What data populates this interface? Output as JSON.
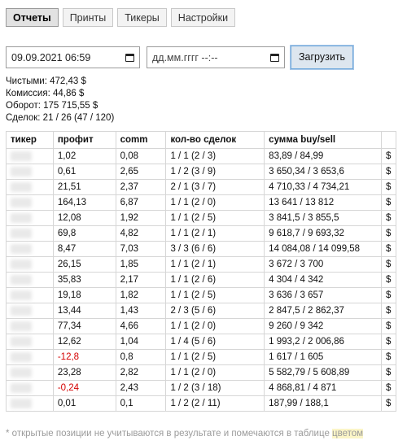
{
  "tabs": [
    "Отчеты",
    "Принты",
    "Тикеры",
    "Настройки"
  ],
  "active_tab": 0,
  "controls": {
    "date_from": "09.09.2021 06:59",
    "date_to_placeholder": "дд.мм.гггг --:--",
    "load_label": "Загрузить"
  },
  "stats": [
    "Чистыми: 472,43 $",
    "Комиссия: 44,86 $",
    "Оборот: 175 715,55 $",
    "Сделок: 21 / 26 (47 / 120)"
  ],
  "table": {
    "headers": [
      "тикер",
      "профит",
      "comm",
      "кол-во сделок",
      "сумма buy/sell",
      ""
    ],
    "rows": [
      {
        "profit": "1,02",
        "comm": "0,08",
        "deals": "1 / 1 (2 / 3)",
        "sum": "83,89 / 84,99",
        "cur": "$",
        "neg": false
      },
      {
        "profit": "0,61",
        "comm": "2,65",
        "deals": "1 / 2 (3 / 9)",
        "sum": "3 650,34 / 3 653,6",
        "cur": "$",
        "neg": false
      },
      {
        "profit": "21,51",
        "comm": "2,37",
        "deals": "2 / 1 (3 / 7)",
        "sum": "4 710,33 / 4 734,21",
        "cur": "$",
        "neg": false
      },
      {
        "profit": "164,13",
        "comm": "6,87",
        "deals": "1 / 1 (2 / 0)",
        "sum": "13 641 / 13 812",
        "cur": "$",
        "neg": false
      },
      {
        "profit": "12,08",
        "comm": "1,92",
        "deals": "1 / 1 (2 / 5)",
        "sum": "3 841,5 / 3 855,5",
        "cur": "$",
        "neg": false
      },
      {
        "profit": "69,8",
        "comm": "4,82",
        "deals": "1 / 1 (2 / 1)",
        "sum": "9 618,7 / 9 693,32",
        "cur": "$",
        "neg": false
      },
      {
        "profit": "8,47",
        "comm": "7,03",
        "deals": "3 / 3 (6 / 6)",
        "sum": "14 084,08 / 14 099,58",
        "cur": "$",
        "neg": false
      },
      {
        "profit": "26,15",
        "comm": "1,85",
        "deals": "1 / 1 (2 / 1)",
        "sum": "3 672 / 3 700",
        "cur": "$",
        "neg": false
      },
      {
        "profit": "35,83",
        "comm": "2,17",
        "deals": "1 / 1 (2 / 6)",
        "sum": "4 304 / 4 342",
        "cur": "$",
        "neg": false
      },
      {
        "profit": "19,18",
        "comm": "1,82",
        "deals": "1 / 1 (2 / 5)",
        "sum": "3 636 / 3 657",
        "cur": "$",
        "neg": false
      },
      {
        "profit": "13,44",
        "comm": "1,43",
        "deals": "2 / 3 (5 / 6)",
        "sum": "2 847,5 / 2 862,37",
        "cur": "$",
        "neg": false
      },
      {
        "profit": "77,34",
        "comm": "4,66",
        "deals": "1 / 1 (2 / 0)",
        "sum": "9 260 / 9 342",
        "cur": "$",
        "neg": false
      },
      {
        "profit": "12,62",
        "comm": "1,04",
        "deals": "1 / 4 (5 / 6)",
        "sum": "1 993,2 / 2 006,86",
        "cur": "$",
        "neg": false
      },
      {
        "profit": "-12,8",
        "comm": "0,8",
        "deals": "1 / 1 (2 / 5)",
        "sum": "1 617 / 1 605",
        "cur": "$",
        "neg": true
      },
      {
        "profit": "23,28",
        "comm": "2,82",
        "deals": "1 / 1 (2 / 0)",
        "sum": "5 582,79 / 5 608,89",
        "cur": "$",
        "neg": false
      },
      {
        "profit": "-0,24",
        "comm": "2,43",
        "deals": "1 / 2 (3 / 18)",
        "sum": "4 868,81 / 4 871",
        "cur": "$",
        "neg": true
      },
      {
        "profit": "0,01",
        "comm": "0,1",
        "deals": "1 / 2 (2 / 11)",
        "sum": "187,99 / 188,1",
        "cur": "$",
        "neg": false
      }
    ]
  },
  "footnote": {
    "text": "* открытые позиции не учитываются в результате и помечаются в таблице ",
    "highlight": "цветом"
  },
  "colors": {
    "negative": "#d40000",
    "highlight": "#fbf5c7",
    "button_border": "#6fa8dc"
  }
}
